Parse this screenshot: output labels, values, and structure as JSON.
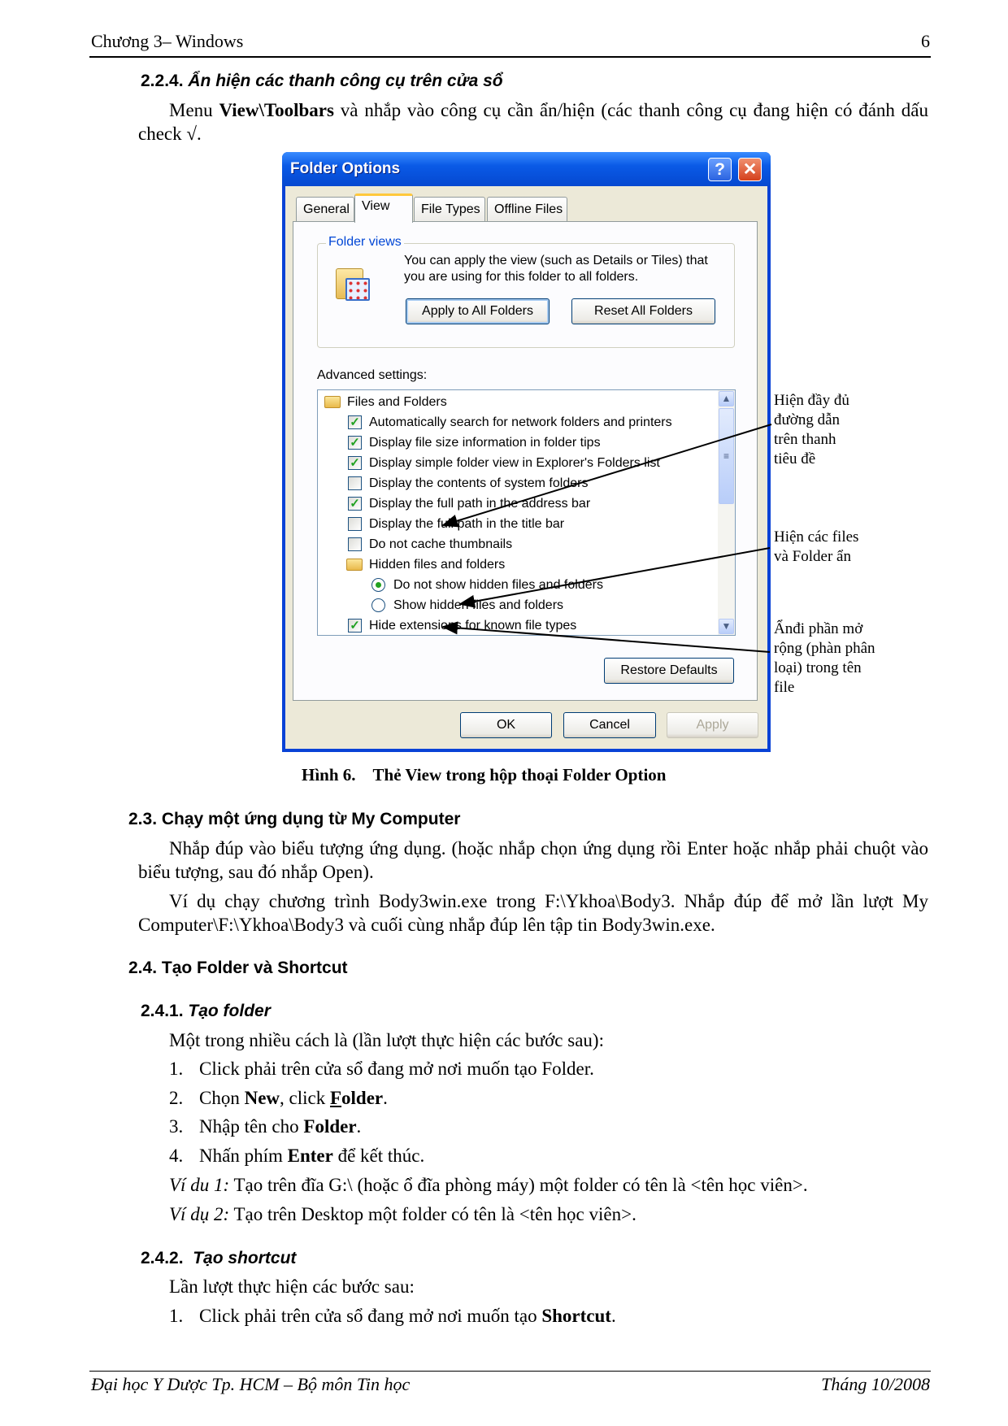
{
  "header": {
    "chapter": "Chương 3– Windows",
    "page_number": "6"
  },
  "section_224": {
    "heading_number": "2.2.4.",
    "heading_title": "Ẩn hiện các thanh công cụ trên cửa sổ",
    "para": [
      "Menu ",
      "View\\Toolbars",
      " và nhắp vào công cụ cần ẩn/hiện (các thanh công cụ đang hiện có đánh dấu check √."
    ]
  },
  "dialog": {
    "title": "Folder Options",
    "help_glyph": "?",
    "close_glyph": "✕",
    "tabs": [
      {
        "label": "General"
      },
      {
        "label": "View",
        "selected": true
      },
      {
        "label": "File Types"
      },
      {
        "label": "Offline Files"
      }
    ],
    "folder_views": {
      "label": "Folder views",
      "description_1": "You can apply the view (such as Details or Tiles) that",
      "description_2": "you are using for this folder to all folders.",
      "apply_all": "Apply to All Folders",
      "reset_all": "Reset All Folders"
    },
    "advanced_label": "Advanced settings:",
    "settings": [
      {
        "type": "folder",
        "label": "Files and Folders"
      },
      {
        "type": "checkbox",
        "checked": true,
        "label": "Automatically search for network folders and printers"
      },
      {
        "type": "checkbox",
        "checked": true,
        "label": "Display file size information in folder tips"
      },
      {
        "type": "checkbox",
        "checked": true,
        "label": "Display simple folder view in Explorer's Folders list"
      },
      {
        "type": "checkbox",
        "checked": false,
        "label": "Display the contents of system folders"
      },
      {
        "type": "checkbox",
        "checked": true,
        "label": "Display the full path in the address bar"
      },
      {
        "type": "checkbox",
        "checked": false,
        "label": "Display the full path in the title bar"
      },
      {
        "type": "checkbox",
        "checked": false,
        "label": "Do not cache thumbnails"
      },
      {
        "type": "subfolder",
        "label": "Hidden files and folders"
      },
      {
        "type": "radio",
        "checked": true,
        "label": "Do not show hidden files and folders"
      },
      {
        "type": "radio",
        "checked": false,
        "label": "Show hidden files and folders"
      },
      {
        "type": "checkbox",
        "checked": true,
        "label": "Hide extensions for known file types"
      }
    ],
    "restore_defaults": "Restore Defaults",
    "ok": "OK",
    "cancel": "Cancel",
    "apply": "Apply",
    "colors": {
      "title_bar": "#0a5ae6",
      "body": "#ece9d8",
      "group_label": "#0046d5",
      "check": "#21a121"
    }
  },
  "annotations": [
    {
      "lines": [
        "Hiện đầy đủ",
        "đường dẫn",
        "trên thanh",
        "tiêu đề"
      ]
    },
    {
      "lines": [
        "Hiện các files",
        "và Folder ẩn"
      ]
    },
    {
      "lines": [
        "Ẩnđi phần mở",
        "rộng (phàn phân",
        "loại) trong tên",
        "file"
      ]
    }
  ],
  "caption": {
    "number": "Hình 6.",
    "text": "Thẻ View trong hộp thoại Folder Option"
  },
  "section_23": {
    "heading": "2.3. Chạy một ứng dụng từ My Computer",
    "para1": "Nhắp đúp vào biểu tượng ứng dụng. (hoặc nhắp chọn ứng dụng rồi Enter hoặc nhắp phải chuột vào biểu tượng, sau đó nhắp Open).",
    "para2": "Ví dụ chạy chương trình Body3win.exe trong F:\\Ykhoa\\Body3. Nhắp đúp để mở lần lượt My Computer\\F:\\Ykhoa\\Body3 và cuối cùng nhắp đúp lên tập tin Body3win.exe."
  },
  "section_24": {
    "heading": "2.4. Tạo Folder và Shortcut"
  },
  "section_241": {
    "heading_number": "2.4.1.",
    "heading_title": "Tạo folder",
    "intro": "Một trong nhiều cách là (lần lượt thực hiện các bước sau):",
    "steps": [
      {
        "n": "1.",
        "a": "Click phải trên cửa sổ đang mở nơi muốn tạo Folder."
      },
      {
        "n": "2.",
        "a": "Chọn ",
        "b": "New",
        "c": ", click ",
        "d": "F",
        "e": "older",
        "f": "."
      },
      {
        "n": "3.",
        "a": "Nhập tên cho ",
        "b": "Folder",
        "c": "."
      },
      {
        "n": "4.",
        "a": "Nhấn phím ",
        "b": "Enter",
        "c": " để kết thúc."
      }
    ],
    "example1_label": "Ví du 1:",
    "example1_text": " Tạo trên đĩa G:\\ (hoặc ổ đĩa phòng máy) một folder có tên là <tên học viên>.",
    "example2_label": "Ví dụ 2:",
    "example2_text": " Tạo trên Desktop một folder có tên là <tên học viên>."
  },
  "section_242": {
    "heading_number": "2.4.2.",
    "heading_title": "Tạo shortcut",
    "intro": "Lần lượt thực hiện các bước sau:",
    "steps": [
      {
        "n": "1.",
        "a": "Click phải trên cửa sổ đang mở nơi muốn tạo ",
        "b": "Shortcut",
        "c": "."
      }
    ]
  },
  "footer": {
    "left": "Đại học Y Dược Tp. HCM – Bộ môn Tin học",
    "right": "Tháng 10/2008"
  }
}
